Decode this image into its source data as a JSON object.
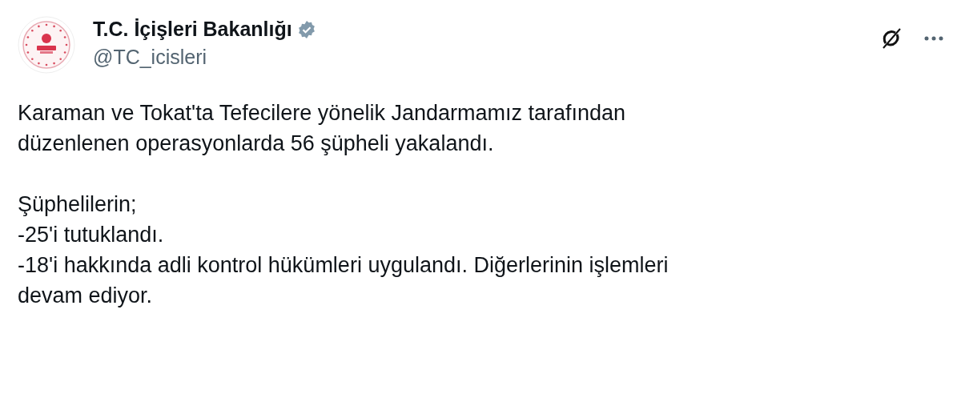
{
  "author": {
    "name": "T.C. İçişleri Bakanlığı",
    "verified": true,
    "handle": "@TC_icisleri"
  },
  "paragraphs": [
    {
      "lines": [
        "Karaman ve Tokat'ta Tefecilere yönelik Jandarmamız tarafından",
        "düzenlenen operasyonlarda 56 şüpheli yakalandı."
      ]
    },
    {
      "lines": [
        "Şüphelilerin;",
        "-25'i tutuklandı.",
        "-18'i hakkında adli kontrol hükümleri uygulandı. Diğerlerinin işlemleri",
        "devam ediyor."
      ]
    }
  ]
}
